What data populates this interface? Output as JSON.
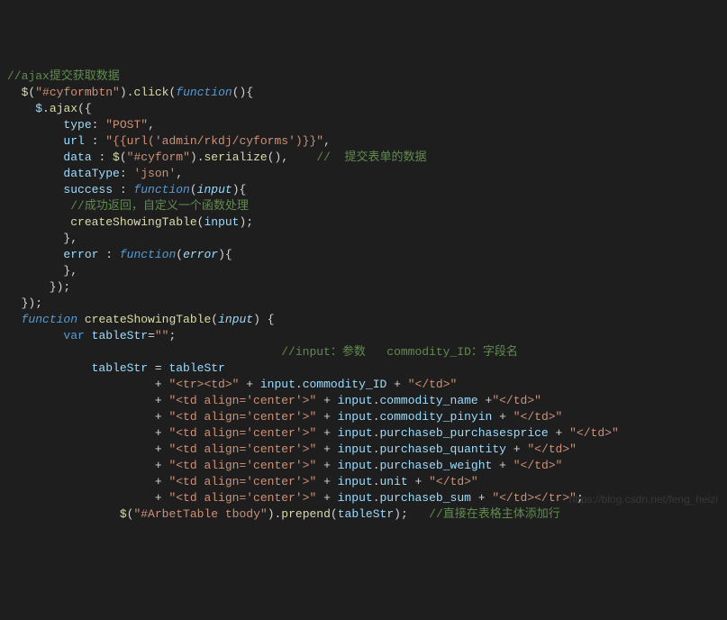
{
  "lines": [
    {
      "c": "cm",
      "t": "//ajax提交获取数据"
    },
    {
      "segs": [
        {
          "c": "op",
          "t": "  "
        },
        {
          "c": "fn",
          "t": "$"
        },
        {
          "c": "op",
          "t": "("
        },
        {
          "c": "st",
          "t": "\"#cyformbtn\""
        },
        {
          "c": "op",
          "t": ")."
        },
        {
          "c": "fn",
          "t": "click"
        },
        {
          "c": "op",
          "t": "("
        },
        {
          "c": "bi",
          "t": "function"
        },
        {
          "c": "op",
          "t": "(){"
        }
      ]
    },
    {
      "segs": [
        {
          "c": "op",
          "t": "    "
        },
        {
          "c": "va",
          "t": "$"
        },
        {
          "c": "op",
          "t": "."
        },
        {
          "c": "fn",
          "t": "ajax"
        },
        {
          "c": "op",
          "t": "({"
        }
      ]
    },
    {
      "segs": [
        {
          "c": "op",
          "t": "        "
        },
        {
          "c": "pr",
          "t": "type"
        },
        {
          "c": "op",
          "t": ": "
        },
        {
          "c": "st",
          "t": "\"POST\""
        },
        {
          "c": "op",
          "t": ","
        }
      ]
    },
    {
      "segs": [
        {
          "c": "op",
          "t": "        "
        },
        {
          "c": "pr",
          "t": "url"
        },
        {
          "c": "op",
          "t": " : "
        },
        {
          "c": "st",
          "t": "\"{{url('admin/rkdj/cyforms')}}\""
        },
        {
          "c": "op",
          "t": ","
        }
      ]
    },
    {
      "segs": [
        {
          "c": "op",
          "t": "        "
        },
        {
          "c": "pr",
          "t": "data"
        },
        {
          "c": "op",
          "t": " : "
        },
        {
          "c": "fn",
          "t": "$"
        },
        {
          "c": "op",
          "t": "("
        },
        {
          "c": "st",
          "t": "\"#cyform\""
        },
        {
          "c": "op",
          "t": ")."
        },
        {
          "c": "fn",
          "t": "serialize"
        },
        {
          "c": "op",
          "t": "(),    "
        },
        {
          "c": "cm",
          "t": "//  提交表单的数据"
        }
      ]
    },
    {
      "segs": [
        {
          "c": "op",
          "t": "        "
        },
        {
          "c": "pr",
          "t": "dataType"
        },
        {
          "c": "op",
          "t": ": "
        },
        {
          "c": "st",
          "t": "'json'"
        },
        {
          "c": "op",
          "t": ","
        }
      ]
    },
    {
      "segs": [
        {
          "c": "op",
          "t": "        "
        },
        {
          "c": "pr",
          "t": "success"
        },
        {
          "c": "op",
          "t": " : "
        },
        {
          "c": "bi",
          "t": "function"
        },
        {
          "c": "op",
          "t": "("
        },
        {
          "c": "pa",
          "t": "input"
        },
        {
          "c": "op",
          "t": "){"
        }
      ]
    },
    {
      "segs": [
        {
          "c": "op",
          "t": "         "
        },
        {
          "c": "cm",
          "t": "//成功返回，自定义一个函数处理"
        }
      ]
    },
    {
      "segs": [
        {
          "c": "op",
          "t": "         "
        },
        {
          "c": "fn",
          "t": "createShowingTable"
        },
        {
          "c": "op",
          "t": "("
        },
        {
          "c": "va",
          "t": "input"
        },
        {
          "c": "op",
          "t": ");"
        }
      ]
    },
    {
      "segs": [
        {
          "c": "op",
          "t": "        },"
        }
      ]
    },
    {
      "segs": [
        {
          "c": "op",
          "t": "        "
        },
        {
          "c": "pr",
          "t": "error"
        },
        {
          "c": "op",
          "t": " : "
        },
        {
          "c": "bi",
          "t": "function"
        },
        {
          "c": "op",
          "t": "("
        },
        {
          "c": "pa",
          "t": "error"
        },
        {
          "c": "op",
          "t": "){"
        }
      ]
    },
    {
      "segs": [
        {
          "c": "op",
          "t": ""
        }
      ]
    },
    {
      "segs": [
        {
          "c": "op",
          "t": "        },"
        }
      ]
    },
    {
      "segs": [
        {
          "c": "op",
          "t": "      });"
        }
      ]
    },
    {
      "segs": [
        {
          "c": "op",
          "t": "  });"
        }
      ]
    },
    {
      "segs": [
        {
          "c": "op",
          "t": ""
        }
      ]
    },
    {
      "segs": [
        {
          "c": "op",
          "t": "  "
        },
        {
          "c": "bi",
          "t": "function"
        },
        {
          "c": "op",
          "t": " "
        },
        {
          "c": "fn",
          "t": "createShowingTable"
        },
        {
          "c": "op",
          "t": "("
        },
        {
          "c": "pa",
          "t": "input"
        },
        {
          "c": "op",
          "t": ") {"
        }
      ]
    },
    {
      "segs": [
        {
          "c": "op",
          "t": ""
        }
      ]
    },
    {
      "segs": [
        {
          "c": "op",
          "t": "        "
        },
        {
          "c": "kw",
          "t": "var"
        },
        {
          "c": "op",
          "t": " "
        },
        {
          "c": "va",
          "t": "tableStr"
        },
        {
          "c": "op",
          "t": "="
        },
        {
          "c": "st",
          "t": "\"\""
        },
        {
          "c": "op",
          "t": ";"
        }
      ]
    },
    {
      "segs": [
        {
          "c": "op",
          "t": "                                       "
        },
        {
          "c": "cm",
          "t": "//input：参数   commodity_ID：字段名"
        }
      ]
    },
    {
      "segs": [
        {
          "c": "op",
          "t": "            "
        },
        {
          "c": "va",
          "t": "tableStr"
        },
        {
          "c": "op",
          "t": " = "
        },
        {
          "c": "va",
          "t": "tableStr"
        }
      ]
    },
    {
      "segs": [
        {
          "c": "op",
          "t": "                     + "
        },
        {
          "c": "st",
          "t": "\"<tr><td>\""
        },
        {
          "c": "op",
          "t": " + "
        },
        {
          "c": "va",
          "t": "input"
        },
        {
          "c": "op",
          "t": "."
        },
        {
          "c": "pr",
          "t": "commodity_ID"
        },
        {
          "c": "op",
          "t": " + "
        },
        {
          "c": "st",
          "t": "\"</td>\""
        }
      ]
    },
    {
      "segs": [
        {
          "c": "op",
          "t": "                     + "
        },
        {
          "c": "st",
          "t": "\"<td align='center'>\""
        },
        {
          "c": "op",
          "t": " + "
        },
        {
          "c": "va",
          "t": "input"
        },
        {
          "c": "op",
          "t": "."
        },
        {
          "c": "pr",
          "t": "commodity_name"
        },
        {
          "c": "op",
          "t": " +"
        },
        {
          "c": "st",
          "t": "\"</td>\""
        }
      ]
    },
    {
      "segs": [
        {
          "c": "op",
          "t": "                     + "
        },
        {
          "c": "st",
          "t": "\"<td align='center'>\""
        },
        {
          "c": "op",
          "t": " + "
        },
        {
          "c": "va",
          "t": "input"
        },
        {
          "c": "op",
          "t": "."
        },
        {
          "c": "pr",
          "t": "commodity_pinyin"
        },
        {
          "c": "op",
          "t": " + "
        },
        {
          "c": "st",
          "t": "\"</td>\""
        }
      ]
    },
    {
      "segs": [
        {
          "c": "op",
          "t": "                     + "
        },
        {
          "c": "st",
          "t": "\"<td align='center'>\""
        },
        {
          "c": "op",
          "t": " + "
        },
        {
          "c": "va",
          "t": "input"
        },
        {
          "c": "op",
          "t": "."
        },
        {
          "c": "pr",
          "t": "purchaseb_purchasesprice"
        },
        {
          "c": "op",
          "t": " + "
        },
        {
          "c": "st",
          "t": "\"</td>\""
        }
      ]
    },
    {
      "segs": [
        {
          "c": "op",
          "t": "                     + "
        },
        {
          "c": "st",
          "t": "\"<td align='center'>\""
        },
        {
          "c": "op",
          "t": " + "
        },
        {
          "c": "va",
          "t": "input"
        },
        {
          "c": "op",
          "t": "."
        },
        {
          "c": "pr",
          "t": "purchaseb_quantity"
        },
        {
          "c": "op",
          "t": " + "
        },
        {
          "c": "st",
          "t": "\"</td>\""
        }
      ]
    },
    {
      "segs": [
        {
          "c": "op",
          "t": "                     + "
        },
        {
          "c": "st",
          "t": "\"<td align='center'>\""
        },
        {
          "c": "op",
          "t": " + "
        },
        {
          "c": "va",
          "t": "input"
        },
        {
          "c": "op",
          "t": "."
        },
        {
          "c": "pr",
          "t": "purchaseb_weight"
        },
        {
          "c": "op",
          "t": " + "
        },
        {
          "c": "st",
          "t": "\"</td>\""
        }
      ]
    },
    {
      "segs": [
        {
          "c": "op",
          "t": "                     + "
        },
        {
          "c": "st",
          "t": "\"<td align='center'>\""
        },
        {
          "c": "op",
          "t": " + "
        },
        {
          "c": "va",
          "t": "input"
        },
        {
          "c": "op",
          "t": "."
        },
        {
          "c": "pr",
          "t": "unit"
        },
        {
          "c": "op",
          "t": " + "
        },
        {
          "c": "st",
          "t": "\"</td>\""
        }
      ]
    },
    {
      "segs": [
        {
          "c": "op",
          "t": "                     + "
        },
        {
          "c": "st",
          "t": "\"<td align='center'>\""
        },
        {
          "c": "op",
          "t": " + "
        },
        {
          "c": "va",
          "t": "input"
        },
        {
          "c": "op",
          "t": "."
        },
        {
          "c": "pr",
          "t": "purchaseb_sum"
        },
        {
          "c": "op",
          "t": " + "
        },
        {
          "c": "st",
          "t": "\"</td></tr>\""
        },
        {
          "c": "op",
          "t": ";"
        }
      ]
    },
    {
      "segs": [
        {
          "c": "op",
          "t": "                "
        },
        {
          "c": "fn",
          "t": "$"
        },
        {
          "c": "op",
          "t": "("
        },
        {
          "c": "st",
          "t": "\"#ArbetTable tbody\""
        },
        {
          "c": "op",
          "t": ")."
        },
        {
          "c": "fn",
          "t": "prepend"
        },
        {
          "c": "op",
          "t": "("
        },
        {
          "c": "va",
          "t": "tableStr"
        },
        {
          "c": "op",
          "t": ");   "
        },
        {
          "c": "cm",
          "t": "//直接在表格主体添加行"
        }
      ]
    }
  ],
  "watermark": "https://blog.csdn.net/feng_heizi"
}
